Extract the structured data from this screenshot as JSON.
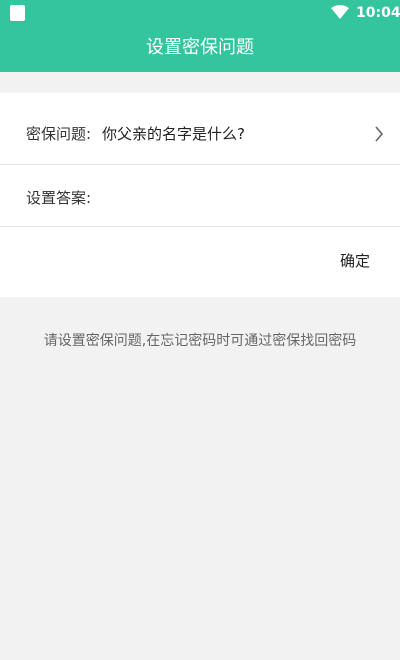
{
  "status_bar": {
    "time": "10:04",
    "icons": [
      "sim-card-icon",
      "wifi-icon"
    ]
  },
  "header": {
    "title": "设置密保问题",
    "background_color": "#34c59f"
  },
  "form": {
    "question_label": "密保问题:",
    "question_value": "你父亲的名字是什么?",
    "answer_label": "设置答案:",
    "answer_value": "",
    "confirm_label": "确定"
  },
  "hint": "请设置密保问题,在忘记密码时可通过密保找回密码"
}
